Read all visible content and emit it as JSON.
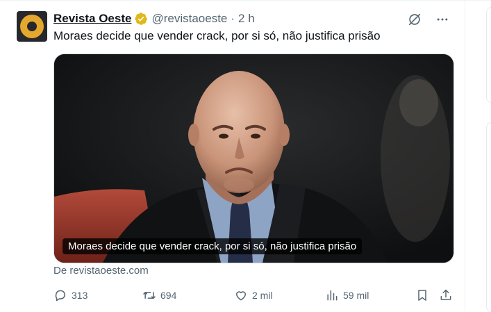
{
  "tweet": {
    "author_name": "Revista Oeste",
    "handle": "@revistaoeste",
    "separator": "·",
    "time": "2 h",
    "text": "Moraes decide que vender crack, por si só, não justifica prisão",
    "verified_badge_color": "#e2b719"
  },
  "media": {
    "caption": "Moraes decide que vender crack, por si só, não justifica prisão"
  },
  "source": {
    "label": "De revistaoeste.com"
  },
  "actions": {
    "replies": "313",
    "reposts": "694",
    "likes": "2 mil",
    "views": "59 mil"
  },
  "icons": {
    "header": [
      "grok-icon",
      "more-icon"
    ],
    "actions": [
      "reply-icon",
      "repost-icon",
      "like-icon",
      "views-icon",
      "bookmark-icon",
      "share-icon"
    ]
  },
  "colors": {
    "text_primary": "#0f1419",
    "text_secondary": "#536471",
    "avatar_bg": "#26282b",
    "avatar_ring": "#e5a82e"
  }
}
